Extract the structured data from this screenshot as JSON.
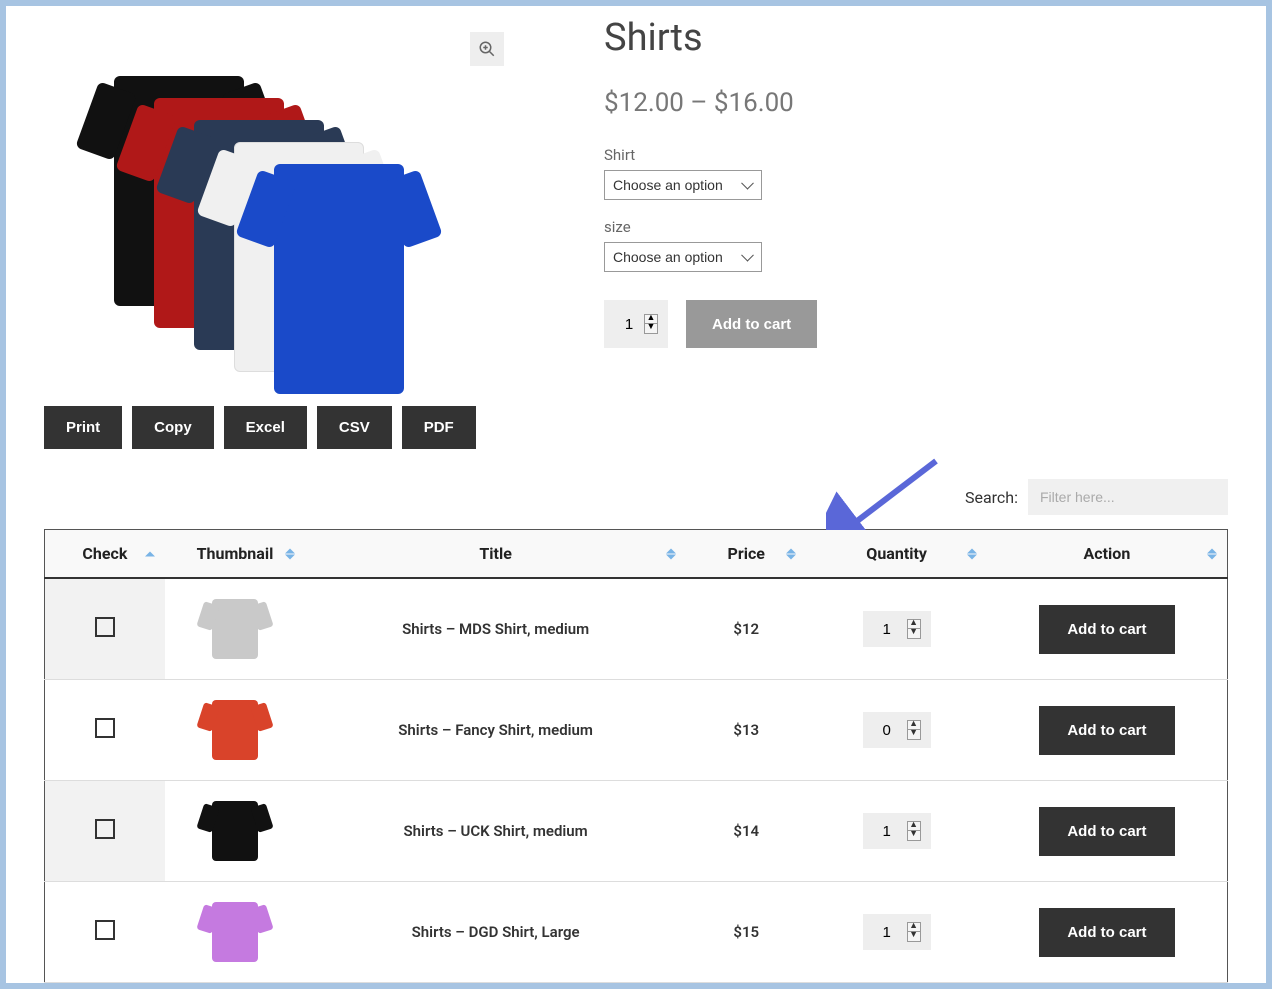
{
  "product": {
    "title": "Shirts",
    "price_range": "$12.00 – $16.00",
    "options": [
      {
        "label": "Shirt",
        "placeholder": "Choose an option"
      },
      {
        "label": "size",
        "placeholder": "Choose an option"
      }
    ],
    "quantity": "1",
    "add_to_cart_label": "Add to cart"
  },
  "export_buttons": [
    "Print",
    "Copy",
    "Excel",
    "CSV",
    "PDF"
  ],
  "search": {
    "label": "Search:",
    "placeholder": "Filter here..."
  },
  "table": {
    "headers": [
      "Check",
      "Thumbnail",
      "Title",
      "Price",
      "Quantity",
      "Action"
    ],
    "action_label": "Add to cart",
    "rows": [
      {
        "title": "Shirts – MDS Shirt, medium",
        "price": "$12",
        "quantity": "1",
        "thumb_color": "#c9c9c9"
      },
      {
        "title": "Shirts – Fancy Shirt, medium",
        "price": "$13",
        "quantity": "0",
        "thumb_color": "#d9432a"
      },
      {
        "title": "Shirts – UCK Shirt, medium",
        "price": "$14",
        "quantity": "1",
        "thumb_color": "#111"
      },
      {
        "title": "Shirts – DGD Shirt, Large",
        "price": "$15",
        "quantity": "1",
        "thumb_color": "#c57ae0"
      }
    ]
  }
}
